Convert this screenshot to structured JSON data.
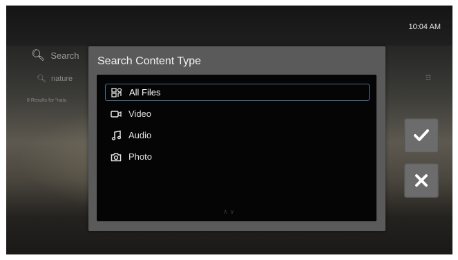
{
  "status": {
    "clock": "10:04 AM"
  },
  "background": {
    "search_label": "Search",
    "query_text": "nature",
    "results_text": "8 Results for \"natu"
  },
  "dialog": {
    "title": "Search Content Type",
    "options": [
      {
        "label": "All Files",
        "icon": "all-files-icon",
        "selected": true
      },
      {
        "label": "Video",
        "icon": "video-camera-icon",
        "selected": false
      },
      {
        "label": "Audio",
        "icon": "music-note-icon",
        "selected": false
      },
      {
        "label": "Photo",
        "icon": "camera-icon",
        "selected": false
      }
    ]
  },
  "side_buttons": {
    "confirm": {
      "icon": "checkmark-icon"
    },
    "cancel": {
      "icon": "x-icon"
    }
  },
  "colors": {
    "selection_border": "#4e6e97",
    "dialog_bg": "#5a5a5a",
    "list_bg": "#050505",
    "button_bg": "#6c6c6c"
  }
}
